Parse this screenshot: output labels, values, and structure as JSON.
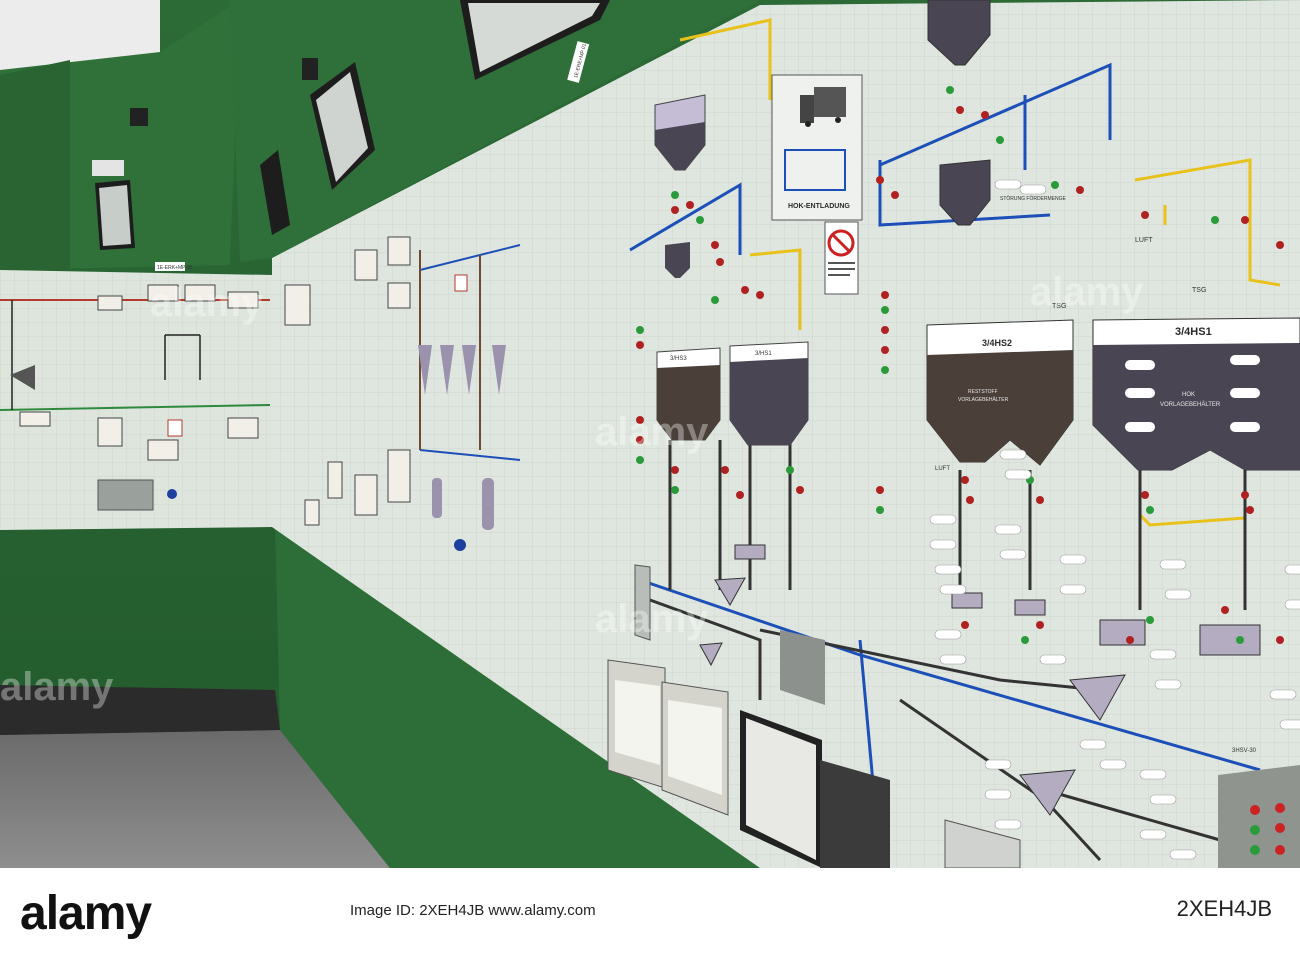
{
  "panel": {
    "label_hs2": "3/4HS2",
    "label_hs1": "3/4HS1",
    "tank_hs2_line1": "RESTSTOFF",
    "tank_hs2_line2": "VORLAGEBEHÄLTER",
    "tank_hs1_line1": "HOK",
    "tank_hs1_line2": "VORLAGEBEHÄLTER",
    "hok_entladung": "HOK-ENTLADUNG",
    "luft_right": "LUFT",
    "luft_mid": "LUFT",
    "tsg_1": "TSG",
    "tsg_2": "TSG",
    "stoerung": "STÖRUNG FÖRDERMENGE",
    "v_3hs1": "3/HS1",
    "v_3hs3": "3/HS3",
    "hsv_30": "3HSV-30",
    "top_plate": "1E-ERE+MP 01",
    "left_plate": "1E-ERK+MP 02"
  },
  "watermark": {
    "text": "alamy"
  },
  "stock": {
    "logo": "alamy",
    "image_id": "2XEH4JB",
    "middle": "Image ID: 2XEH4JB  www.alamy.com"
  },
  "colors": {
    "wall_green": "#2f6b3a",
    "panel_face": "#dfe6df",
    "pipe_blue": "#1d4fb8",
    "pipe_yellow": "#e8c21a",
    "pipe_red": "#b23b2e",
    "tank_dark": "#4a4553",
    "tank_brown": "#4b3f39",
    "tank_light": "#c5bdd6"
  }
}
